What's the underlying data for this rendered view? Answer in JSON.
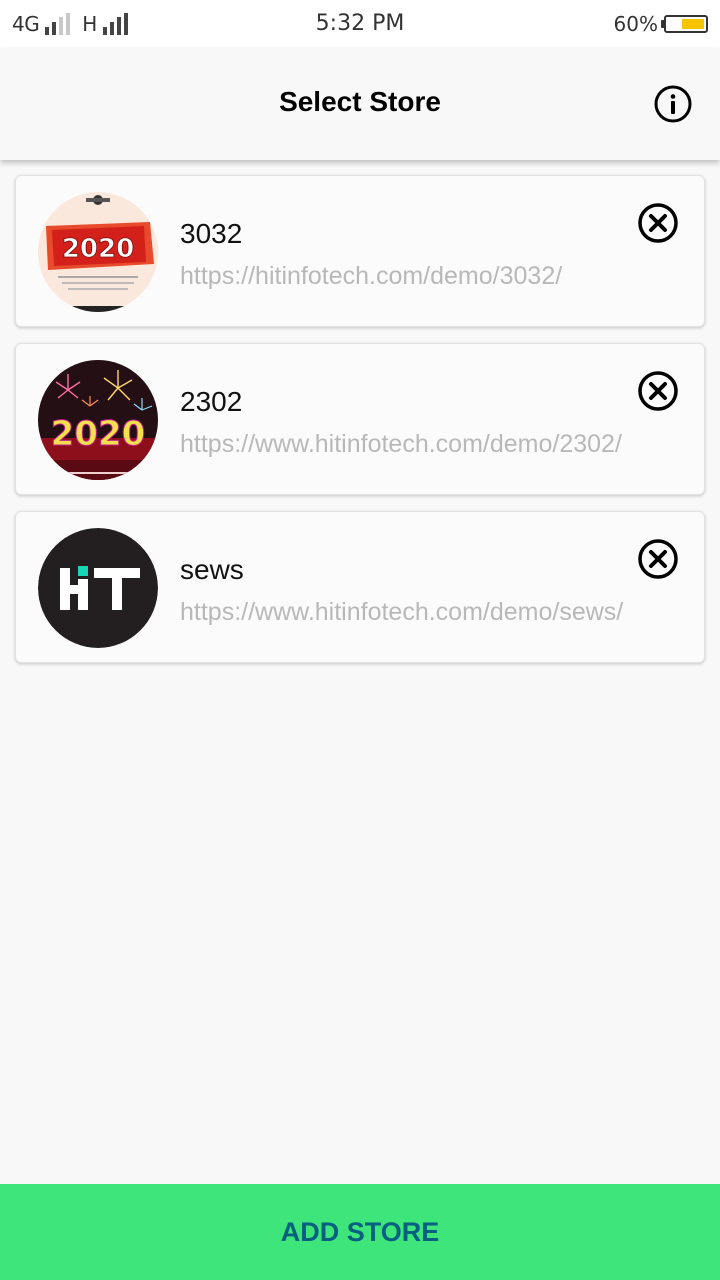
{
  "status_bar": {
    "network_1": "4G",
    "network_2": "H",
    "time": "5:32 PM",
    "battery_percent": "60%",
    "battery_level": 0.6,
    "battery_color": "#f5c400"
  },
  "header": {
    "title": "Select Store",
    "info_icon": "info-circle-icon"
  },
  "stores": [
    {
      "name": "3032",
      "url": "https://hitinfotech.com/demo/3032/",
      "thumbnail": "2020 red banner",
      "thumb_text": "2020"
    },
    {
      "name": "2302",
      "url": "https://www.hitinfotech.com/demo/2302/",
      "thumbnail": "2020 fireworks",
      "thumb_text": "2020"
    },
    {
      "name": "sews",
      "url": "https://www.hitinfotech.com/demo/sews/",
      "thumbnail": "HiT logo",
      "thumb_text": "HT"
    }
  ],
  "footer": {
    "add_store_label": "ADD STORE"
  },
  "colors": {
    "accent_green": "#3de57a",
    "button_text": "#07607f",
    "url_gray": "#b8b8b8",
    "logo_teal": "#17d6b5"
  }
}
